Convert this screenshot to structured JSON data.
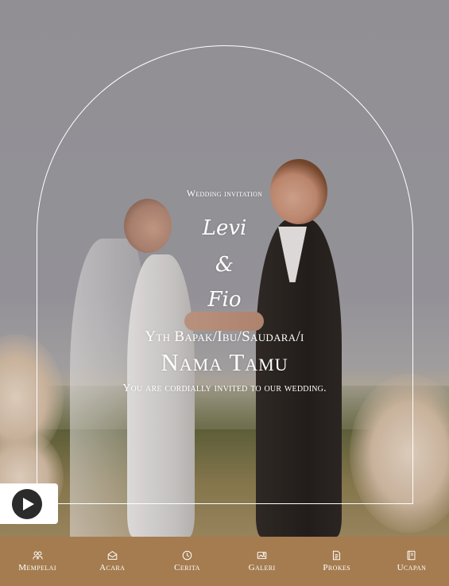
{
  "invitation": {
    "label": "Wedding invitation",
    "groom_name": "Levi",
    "ampersand": "&",
    "bride_name": "Fio",
    "recipient_label": "Yth Bapak/Ibu/Saudara/i",
    "guest_name": "Nama Tamu",
    "invite_note": "You are cordially invited to our wedding."
  },
  "audio": {
    "icon": "play-icon",
    "state": "paused"
  },
  "nav": {
    "items": [
      {
        "label": "Mempelai",
        "icon": "couple-icon"
      },
      {
        "label": "Acara",
        "icon": "envelope-icon"
      },
      {
        "label": "Cerita",
        "icon": "clock-icon"
      },
      {
        "label": "Galeri",
        "icon": "gallery-icon"
      },
      {
        "label": "Prokes",
        "icon": "document-icon"
      },
      {
        "label": "Ucapan",
        "icon": "guestbook-icon"
      }
    ]
  },
  "colors": {
    "nav_background": "#a57c4f",
    "overlay_text": "#ffffff",
    "play_button": "#2b2b2b"
  }
}
